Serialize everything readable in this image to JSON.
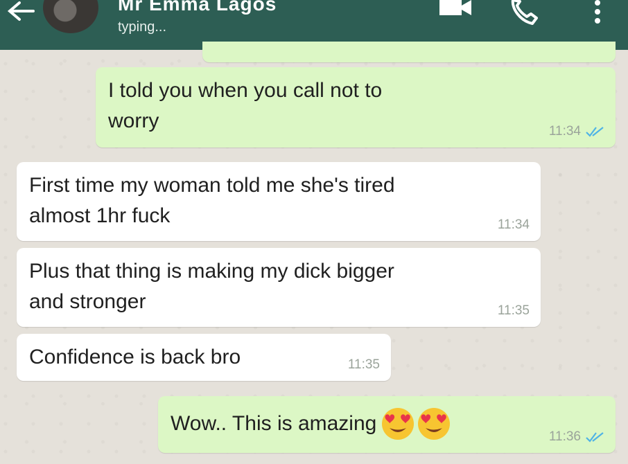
{
  "header": {
    "contact_name": "Mr Emma Lagos",
    "status": "typing..."
  },
  "messages": [
    {
      "direction": "out",
      "lines": [
        "I told you when you call not to",
        "worry"
      ],
      "time": "11:34"
    },
    {
      "direction": "in",
      "lines": [
        "First time my woman told me she's tired",
        "almost 1hr fuck"
      ],
      "time": "11:34"
    },
    {
      "direction": "in",
      "lines": [
        "Plus that thing is making my dick bigger",
        "and stronger"
      ],
      "time": "11:35"
    },
    {
      "direction": "in",
      "lines": [
        "Confidence is back bro"
      ],
      "time": "11:35"
    },
    {
      "direction": "out",
      "lines": [
        "Wow.. This is amazing"
      ],
      "emojis": [
        "heart-eyes-emoji",
        "heart-eyes-emoji"
      ],
      "time": "11:36"
    }
  ],
  "colors": {
    "header": "#2d5e54",
    "outgoing_bubble": "#dcf7c5",
    "incoming_bubble": "#ffffff",
    "read_ticks": "#4fb3e6"
  }
}
